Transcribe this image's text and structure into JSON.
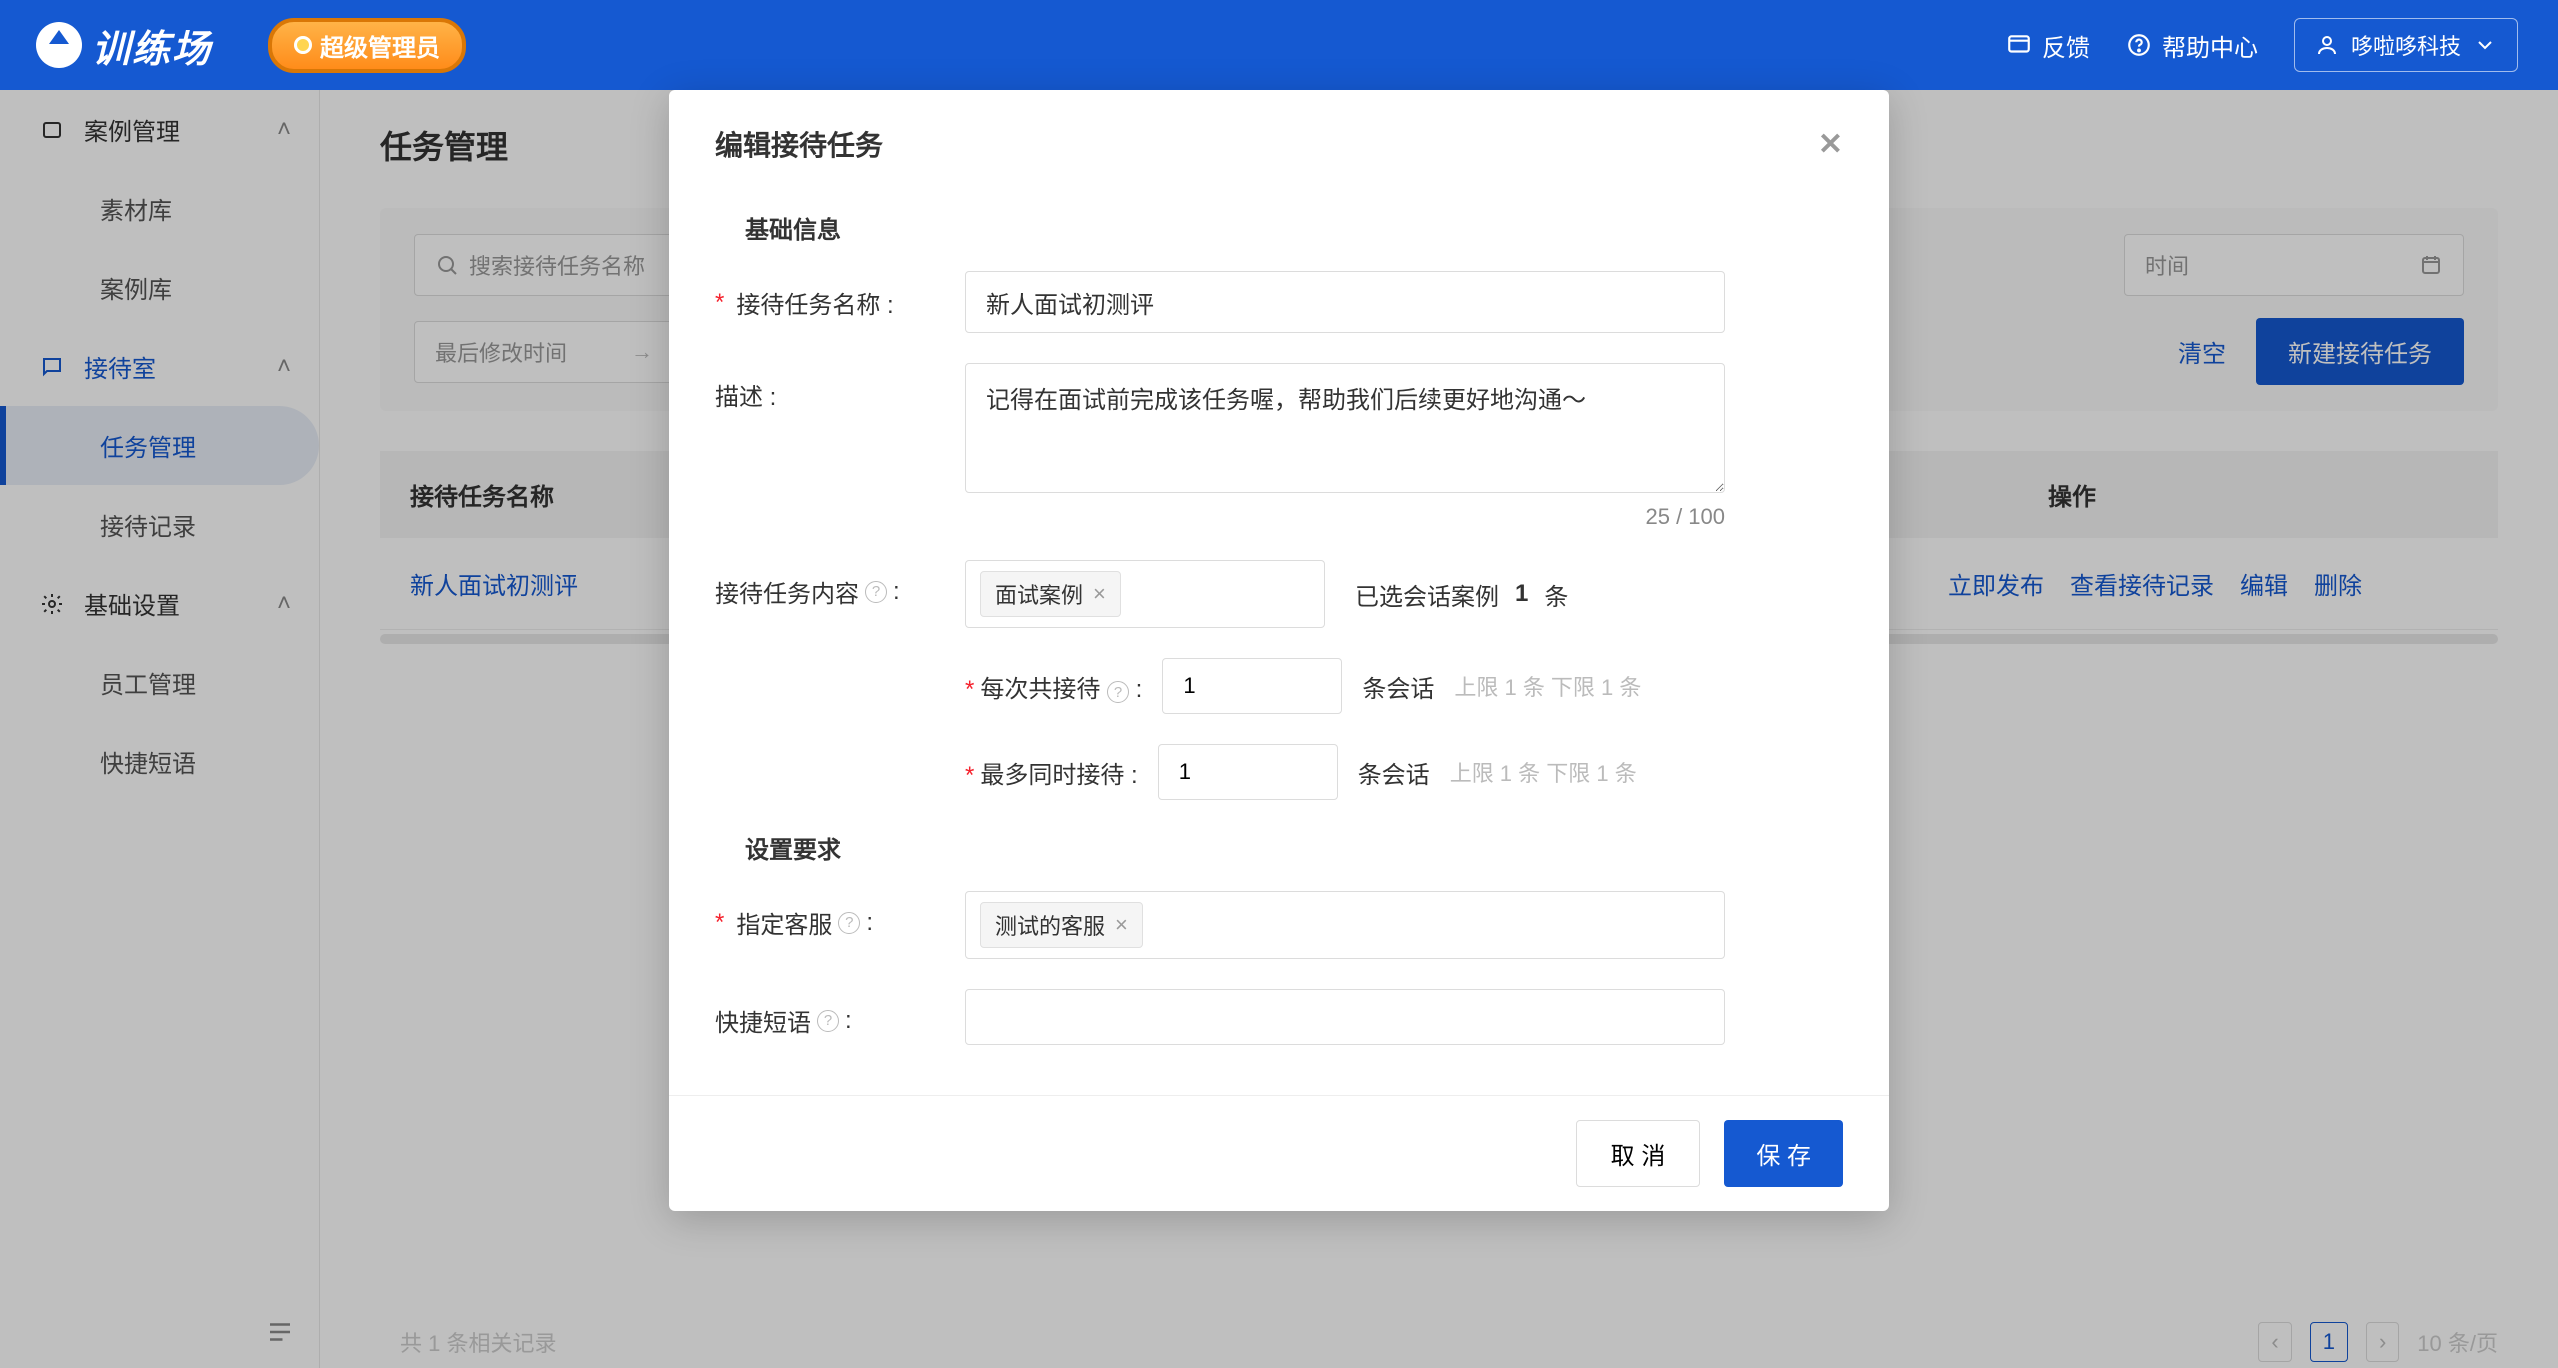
{
  "header": {
    "logo_text": "训练场",
    "admin_badge": "超级管理员",
    "feedback": "反馈",
    "help": "帮助中心",
    "user": "哆啦哆科技"
  },
  "sidebar": {
    "groups": [
      {
        "title": "案例管理",
        "items": [
          "素材库",
          "案例库"
        ]
      },
      {
        "title": "接待室",
        "items": [
          "任务管理",
          "接待记录"
        ],
        "active_item": "任务管理"
      },
      {
        "title": "基础设置",
        "items": [
          "员工管理",
          "快捷短语"
        ]
      }
    ]
  },
  "page": {
    "title": "任务管理",
    "search_placeholder": "搜索接待任务名称",
    "last_modified_label": "最后修改时间",
    "date_placeholder_end": "时间",
    "clear": "清空",
    "create_btn": "新建接待任务",
    "table": {
      "col_name": "接待任务名称",
      "col_ops": "操作",
      "rows": [
        {
          "name": "新人面试初测评",
          "ops": [
            "立即发布",
            "查看接待记录",
            "编辑",
            "删除"
          ]
        }
      ]
    },
    "pager": {
      "total_text": "共 1 条相关记录",
      "page": "1",
      "per_page": "10 条/页"
    }
  },
  "modal": {
    "title": "编辑接待任务",
    "section_basic": "基础信息",
    "fields": {
      "name_label": "接待任务名称 :",
      "name_value": "新人面试初测评",
      "desc_label": "描述 :",
      "desc_value": "记得在面试前完成该任务喔，帮助我们后续更好地沟通～",
      "desc_count": "25 / 100",
      "content_label": "接待任务内容",
      "content_tag": "面试案例",
      "content_selected_prefix": "已选会话案例",
      "content_selected_count": "1",
      "content_selected_suffix": "条",
      "per_time_label": "每次共接待",
      "per_time_value": "1",
      "per_time_unit": "条会话",
      "per_time_hint": "上限 1 条  下限 1 条",
      "max_label": "最多同时接待 :",
      "max_value": "1",
      "max_unit": "条会话",
      "max_hint": "上限 1 条  下限 1 条"
    },
    "section_req": "设置要求",
    "fields2": {
      "agent_label": "指定客服",
      "agent_tag": "测试的客服",
      "quick_label": "快捷短语"
    },
    "footer": {
      "cancel": "取 消",
      "save": "保 存"
    }
  }
}
